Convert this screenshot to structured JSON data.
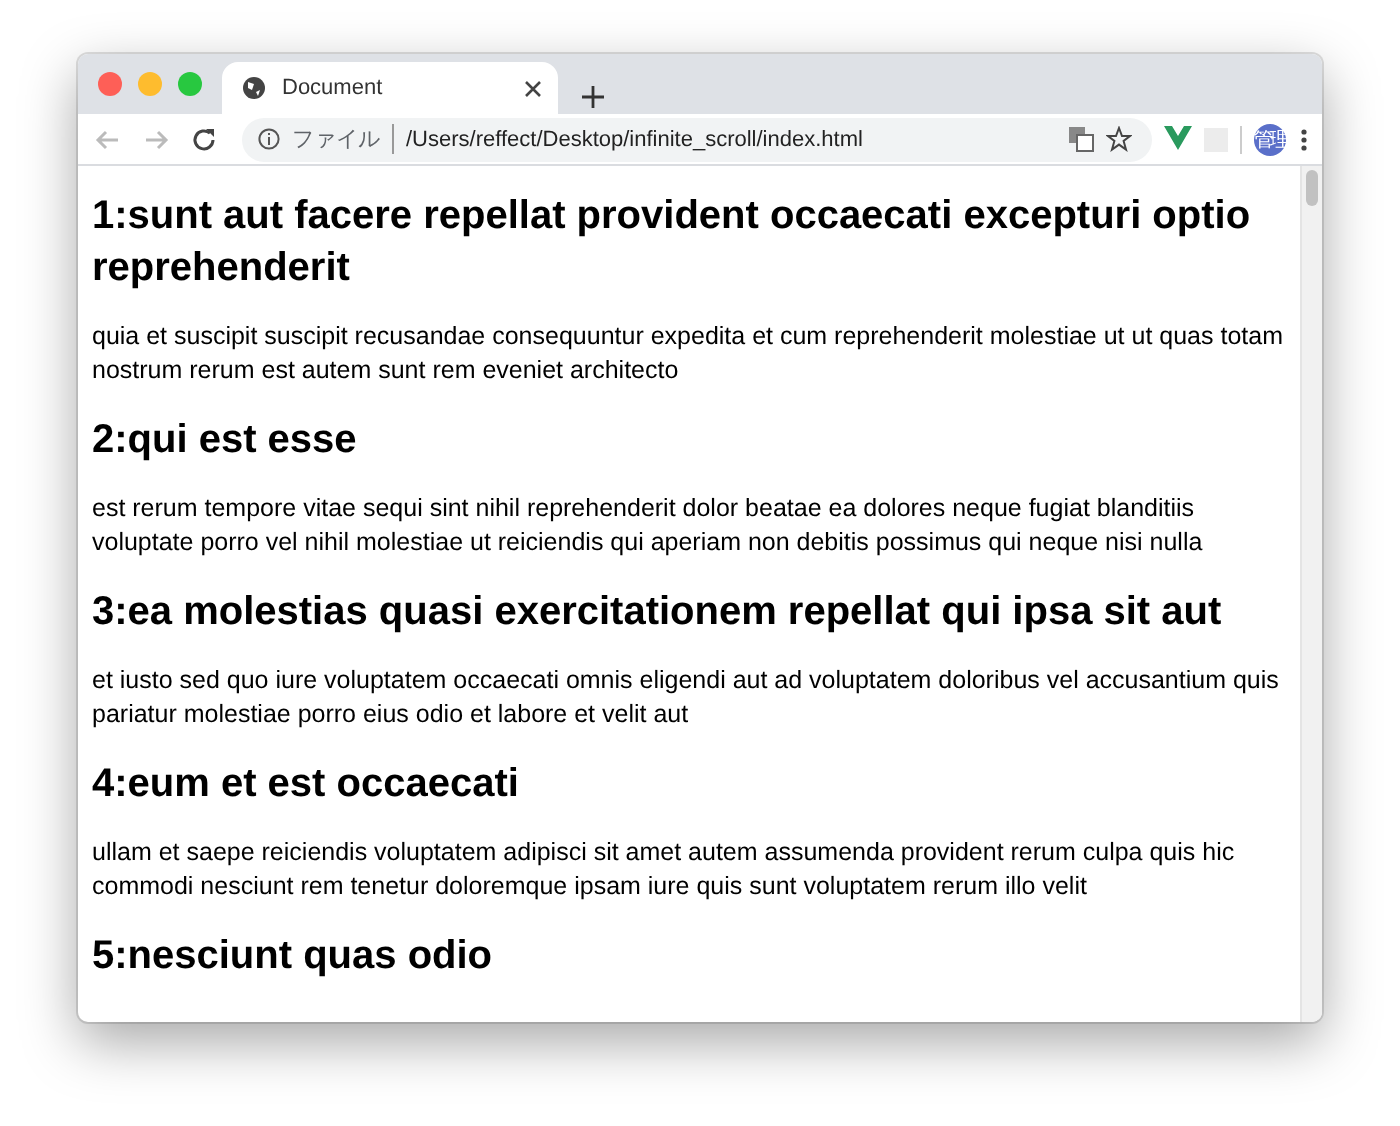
{
  "tab": {
    "title": "Document",
    "selected": true
  },
  "toolbar": {
    "scheme_label": "ファイル",
    "url": "/Users/reffect/Desktop/infinite_scroll/index.html",
    "avatar": "管理"
  },
  "posts": [
    {
      "title": "1:sunt aut facere repellat provident occaecati excepturi optio reprehenderit",
      "body": "quia et suscipit suscipit recusandae consequuntur expedita et cum reprehenderit molestiae ut ut quas totam nostrum rerum est autem sunt rem eveniet architecto"
    },
    {
      "title": "2:qui est esse",
      "body": "est rerum tempore vitae sequi sint nihil reprehenderit dolor beatae ea dolores neque fugiat blanditiis voluptate porro vel nihil molestiae ut reiciendis qui aperiam non debitis possimus qui neque nisi nulla"
    },
    {
      "title": "3:ea molestias quasi exercitationem repellat qui ipsa sit aut",
      "body": "et iusto sed quo iure voluptatem occaecati omnis eligendi aut ad voluptatem doloribus vel accusantium quis pariatur molestiae porro eius odio et labore et velit aut"
    },
    {
      "title": "4:eum et est occaecati",
      "body": "ullam et saepe reiciendis voluptatem adipisci sit amet autem assumenda provident rerum culpa quis hic commodi nesciunt rem tenetur doloremque ipsam iure quis sunt voluptatem rerum illo velit"
    },
    {
      "title": "5:nesciunt quas odio"
    }
  ]
}
